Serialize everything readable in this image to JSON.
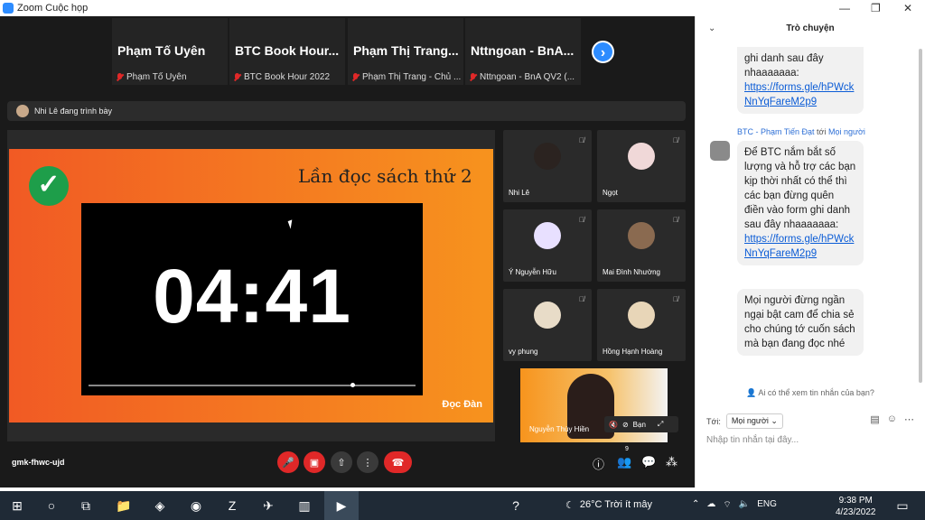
{
  "window": {
    "title": "Zoom Cuộc họp"
  },
  "gallery": {
    "participants": [
      {
        "name": "Phạm Tố Uyên",
        "label": "Phạm Tố Uyên"
      },
      {
        "name": "BTC Book Hour...",
        "label": "BTC Book Hour 2022"
      },
      {
        "name": "Phạm Thị Trang...",
        "label": "Phạm Thị Trang - Chủ ..."
      },
      {
        "name": "Nttngoan - BnA...",
        "label": "Nttngoan - BnA QV2 (..."
      }
    ]
  },
  "presenting": {
    "text": "Nhi Lê đang trình bày"
  },
  "slide": {
    "title": "Lần đọc sách thứ 2",
    "timer": "04:41",
    "progress": 0.8,
    "brand": "Đọc Đàn"
  },
  "tiles": [
    {
      "name": "Nhi Lê"
    },
    {
      "name": "Ngọt"
    },
    {
      "name": "Ý Nguyễn Hữu"
    },
    {
      "name": "Mai Đình Nhường"
    },
    {
      "name": "vy phung"
    },
    {
      "name": "Hồng Hạnh Hoàng"
    }
  ],
  "selfview": {
    "name": "Nguyễn Thùy Hiền",
    "label": "Bạn"
  },
  "toolbar": {
    "meeting_id": "gmk-fhwc-ujd",
    "participant_count": "9"
  },
  "chat": {
    "title": "Trò chuyện",
    "messages": [
      {
        "text": "ghi danh sau đây nhaaaaaaa:",
        "link": "https://forms.gle/hPWckNnYqFareM2p9"
      },
      {
        "sender": "BTC - Phạm Tiến Đạt",
        "to_word": "tới",
        "to": "Mọi người",
        "text": "Để BTC nắm bắt số lượng và hỗ trợ các bạn kịp thời nhất có thể thì các bạn đừng quên điền vào form ghi danh sau đây nhaaaaaaa:",
        "link": "https://forms.gle/hPWckNnYqFareM2p9"
      },
      {
        "text": "Mọi người đừng ngần ngại bật cam để chia sẻ cho chúng tớ cuốn sách mà bạn đang đọc nhé"
      }
    ],
    "privacy": "Ai có thể xem tin nhắn của bạn?",
    "to_label": "Tới:",
    "to_value": "Mọi người",
    "input_placeholder": "Nhập tin nhắn tại đây..."
  },
  "taskbar": {
    "weather": "26°C Trời ít mây",
    "lang": "ENG",
    "time": "9:38 PM",
    "date": "4/23/2022"
  }
}
